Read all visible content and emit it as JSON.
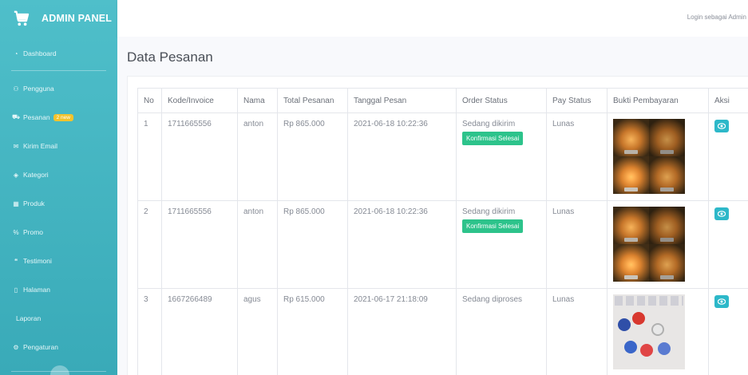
{
  "sidebar": {
    "brand": "ADMIN PANEL",
    "items": [
      {
        "label": "Dashboard",
        "icon": "dashboard-icon"
      },
      {
        "label": "Pengguna",
        "icon": "users-icon"
      },
      {
        "label": "Pesanan",
        "icon": "cart-icon",
        "badge": "2 new"
      },
      {
        "label": "Kirim Email",
        "icon": "mail-icon"
      },
      {
        "label": "Kategori",
        "icon": "tag-icon"
      },
      {
        "label": "Produk",
        "icon": "box-icon"
      },
      {
        "label": "Promo",
        "icon": "percent-icon"
      },
      {
        "label": "Testimoni",
        "icon": "comments-icon"
      },
      {
        "label": "Halaman",
        "icon": "file-icon"
      },
      {
        "label": "Laporan",
        "icon": ""
      },
      {
        "label": "Pengaturan",
        "icon": "gear-icon"
      }
    ]
  },
  "topbar": {
    "login_text": "Login sebagai Admin"
  },
  "page": {
    "title": "Data Pesanan"
  },
  "table": {
    "headers": [
      "No",
      "Kode/Invoice",
      "Nama",
      "Total Pesanan",
      "Tanggal Pesan",
      "Order Status",
      "Pay Status",
      "Bukti Pembayaran",
      "Aksi"
    ],
    "rows": [
      {
        "no": "1",
        "invoice": "1711665556",
        "nama": "anton",
        "total": "Rp 865.000",
        "tanggal": "2021-06-18 10:22:36",
        "order_status": "Sedang dikirim",
        "action_label": "Konfirmasi Selesai",
        "pay_status": "Lunas"
      },
      {
        "no": "2",
        "invoice": "1711665556",
        "nama": "anton",
        "total": "Rp 865.000",
        "tanggal": "2021-06-18 10:22:36",
        "order_status": "Sedang dikirim",
        "action_label": "Konfirmasi Selesai",
        "pay_status": "Lunas"
      },
      {
        "no": "3",
        "invoice": "1667266489",
        "nama": "agus",
        "total": "Rp 615.000",
        "tanggal": "2021-06-17 21:18:09",
        "order_status": "Sedang diproses",
        "action_label": "",
        "pay_status": "Lunas"
      }
    ]
  },
  "colors": {
    "sidebar": "#46b6c3",
    "confirm": "#2dc38b",
    "view_button": "#2db8c9",
    "badge": "#f3c32c"
  }
}
